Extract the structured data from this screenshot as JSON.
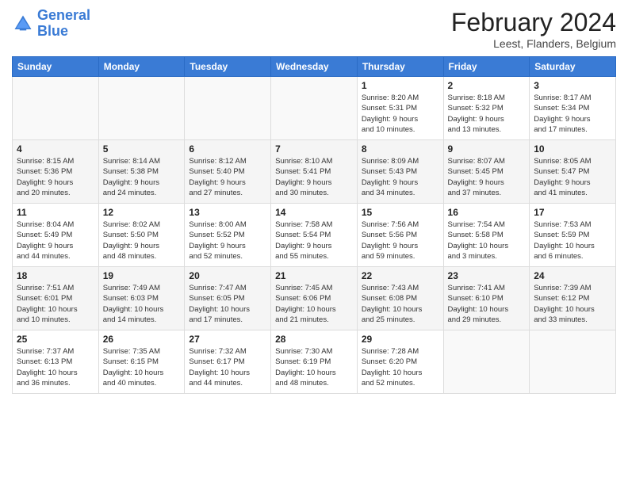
{
  "header": {
    "logo_line1": "General",
    "logo_line2": "Blue",
    "title": "February 2024",
    "location": "Leest, Flanders, Belgium"
  },
  "days_of_week": [
    "Sunday",
    "Monday",
    "Tuesday",
    "Wednesday",
    "Thursday",
    "Friday",
    "Saturday"
  ],
  "weeks": [
    [
      {
        "day": "",
        "info": ""
      },
      {
        "day": "",
        "info": ""
      },
      {
        "day": "",
        "info": ""
      },
      {
        "day": "",
        "info": ""
      },
      {
        "day": "1",
        "info": "Sunrise: 8:20 AM\nSunset: 5:31 PM\nDaylight: 9 hours\nand 10 minutes."
      },
      {
        "day": "2",
        "info": "Sunrise: 8:18 AM\nSunset: 5:32 PM\nDaylight: 9 hours\nand 13 minutes."
      },
      {
        "day": "3",
        "info": "Sunrise: 8:17 AM\nSunset: 5:34 PM\nDaylight: 9 hours\nand 17 minutes."
      }
    ],
    [
      {
        "day": "4",
        "info": "Sunrise: 8:15 AM\nSunset: 5:36 PM\nDaylight: 9 hours\nand 20 minutes."
      },
      {
        "day": "5",
        "info": "Sunrise: 8:14 AM\nSunset: 5:38 PM\nDaylight: 9 hours\nand 24 minutes."
      },
      {
        "day": "6",
        "info": "Sunrise: 8:12 AM\nSunset: 5:40 PM\nDaylight: 9 hours\nand 27 minutes."
      },
      {
        "day": "7",
        "info": "Sunrise: 8:10 AM\nSunset: 5:41 PM\nDaylight: 9 hours\nand 30 minutes."
      },
      {
        "day": "8",
        "info": "Sunrise: 8:09 AM\nSunset: 5:43 PM\nDaylight: 9 hours\nand 34 minutes."
      },
      {
        "day": "9",
        "info": "Sunrise: 8:07 AM\nSunset: 5:45 PM\nDaylight: 9 hours\nand 37 minutes."
      },
      {
        "day": "10",
        "info": "Sunrise: 8:05 AM\nSunset: 5:47 PM\nDaylight: 9 hours\nand 41 minutes."
      }
    ],
    [
      {
        "day": "11",
        "info": "Sunrise: 8:04 AM\nSunset: 5:49 PM\nDaylight: 9 hours\nand 44 minutes."
      },
      {
        "day": "12",
        "info": "Sunrise: 8:02 AM\nSunset: 5:50 PM\nDaylight: 9 hours\nand 48 minutes."
      },
      {
        "day": "13",
        "info": "Sunrise: 8:00 AM\nSunset: 5:52 PM\nDaylight: 9 hours\nand 52 minutes."
      },
      {
        "day": "14",
        "info": "Sunrise: 7:58 AM\nSunset: 5:54 PM\nDaylight: 9 hours\nand 55 minutes."
      },
      {
        "day": "15",
        "info": "Sunrise: 7:56 AM\nSunset: 5:56 PM\nDaylight: 9 hours\nand 59 minutes."
      },
      {
        "day": "16",
        "info": "Sunrise: 7:54 AM\nSunset: 5:58 PM\nDaylight: 10 hours\nand 3 minutes."
      },
      {
        "day": "17",
        "info": "Sunrise: 7:53 AM\nSunset: 5:59 PM\nDaylight: 10 hours\nand 6 minutes."
      }
    ],
    [
      {
        "day": "18",
        "info": "Sunrise: 7:51 AM\nSunset: 6:01 PM\nDaylight: 10 hours\nand 10 minutes."
      },
      {
        "day": "19",
        "info": "Sunrise: 7:49 AM\nSunset: 6:03 PM\nDaylight: 10 hours\nand 14 minutes."
      },
      {
        "day": "20",
        "info": "Sunrise: 7:47 AM\nSunset: 6:05 PM\nDaylight: 10 hours\nand 17 minutes."
      },
      {
        "day": "21",
        "info": "Sunrise: 7:45 AM\nSunset: 6:06 PM\nDaylight: 10 hours\nand 21 minutes."
      },
      {
        "day": "22",
        "info": "Sunrise: 7:43 AM\nSunset: 6:08 PM\nDaylight: 10 hours\nand 25 minutes."
      },
      {
        "day": "23",
        "info": "Sunrise: 7:41 AM\nSunset: 6:10 PM\nDaylight: 10 hours\nand 29 minutes."
      },
      {
        "day": "24",
        "info": "Sunrise: 7:39 AM\nSunset: 6:12 PM\nDaylight: 10 hours\nand 33 minutes."
      }
    ],
    [
      {
        "day": "25",
        "info": "Sunrise: 7:37 AM\nSunset: 6:13 PM\nDaylight: 10 hours\nand 36 minutes."
      },
      {
        "day": "26",
        "info": "Sunrise: 7:35 AM\nSunset: 6:15 PM\nDaylight: 10 hours\nand 40 minutes."
      },
      {
        "day": "27",
        "info": "Sunrise: 7:32 AM\nSunset: 6:17 PM\nDaylight: 10 hours\nand 44 minutes."
      },
      {
        "day": "28",
        "info": "Sunrise: 7:30 AM\nSunset: 6:19 PM\nDaylight: 10 hours\nand 48 minutes."
      },
      {
        "day": "29",
        "info": "Sunrise: 7:28 AM\nSunset: 6:20 PM\nDaylight: 10 hours\nand 52 minutes."
      },
      {
        "day": "",
        "info": ""
      },
      {
        "day": "",
        "info": ""
      }
    ]
  ]
}
